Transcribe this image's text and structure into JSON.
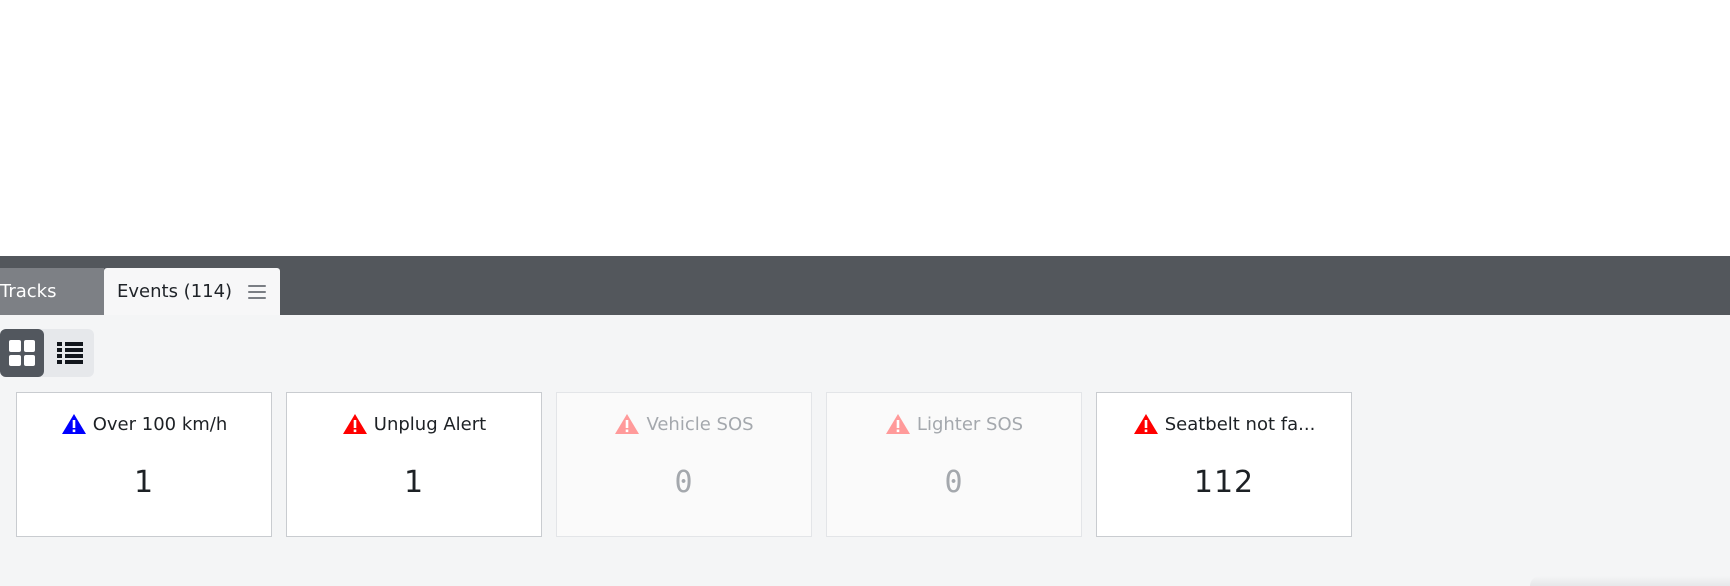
{
  "tabs": {
    "tracks_label": "Tracks",
    "events_label": "Events (114)"
  },
  "view_toggle": {
    "active": "grid"
  },
  "cards": [
    {
      "label": "Over 100 km/h",
      "value": "1",
      "icon": "warning-triangle-icon",
      "icon_color": "#0000ff",
      "disabled": false
    },
    {
      "label": "Unplug Alert",
      "value": "1",
      "icon": "warning-triangle-icon",
      "icon_color": "#ff0000",
      "disabled": false
    },
    {
      "label": "Vehicle SOS",
      "value": "0",
      "icon": "warning-triangle-icon",
      "icon_color": "#ff9a9a",
      "disabled": true
    },
    {
      "label": "Lighter SOS",
      "value": "0",
      "icon": "warning-triangle-icon",
      "icon_color": "#ff9a9a",
      "disabled": true
    },
    {
      "label": "Seatbelt not fa...",
      "value": "112",
      "icon": "warning-triangle-icon",
      "icon_color": "#ff0000",
      "disabled": false
    }
  ],
  "colors": {
    "tabbar_bg": "#53575c",
    "panel_bg": "#f4f5f6"
  }
}
